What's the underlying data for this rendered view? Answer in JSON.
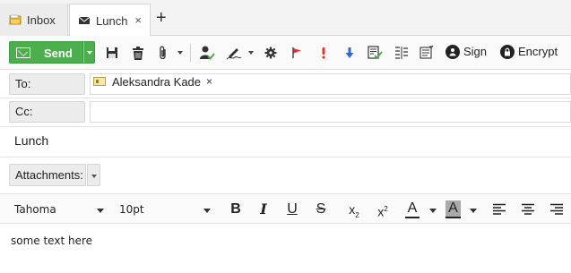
{
  "tabs": [
    {
      "label": "Inbox",
      "icon": "inbox-folder-icon"
    },
    {
      "label": "Lunch",
      "icon": "envelope-icon",
      "close": "×"
    }
  ],
  "tab_add": "+",
  "toolbar": {
    "send_label": "Send",
    "sign_label": "Sign",
    "encrypt_label": "Encrypt",
    "icons": [
      "save-icon",
      "trash-icon",
      "paperclip-icon",
      "contact-check-icon",
      "signature-pen-icon",
      "gear-icon",
      "flag-icon",
      "priority-high-icon",
      "priority-low-icon",
      "read-receipt-icon",
      "list-icon",
      "list-options-icon"
    ],
    "accent_color": "#4cae4c"
  },
  "fields": {
    "to_label": "To:",
    "to_recipient": "Aleksandra Kade",
    "chip_close": "×",
    "cc_label": "Cc:",
    "cc_value": "",
    "subject": "Lunch",
    "attachments_label": "Attachments:"
  },
  "format": {
    "font": "Tahoma",
    "size": "10pt",
    "bold": "B",
    "italic": "I",
    "underline": "U",
    "strike": "S",
    "subscript": "x",
    "subscript_mark": "2",
    "superscript": "x",
    "superscript_mark": "2",
    "text_color": "A",
    "highlight": "A"
  },
  "body_text": "some text here"
}
